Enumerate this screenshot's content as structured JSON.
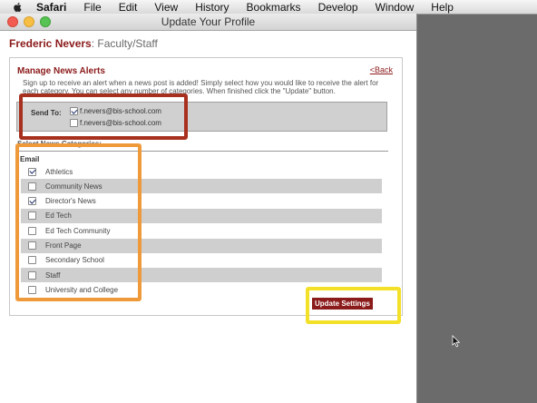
{
  "menubar": {
    "items": [
      "Safari",
      "File",
      "Edit",
      "View",
      "History",
      "Bookmarks",
      "Develop",
      "Window",
      "Help"
    ]
  },
  "window": {
    "title": "Update Your Profile"
  },
  "profile": {
    "name": "Frederic Nevers",
    "role": ": Faculty/Staff"
  },
  "alerts": {
    "title": "Manage News Alerts",
    "back_label": "<Back",
    "intro": "Sign up to receive an alert when a news post is added! Simply select how you would like to receive the alert for each category. You can select any number of categories. When finished click the \"Update\" button.",
    "send_to_label": "Send To:",
    "emails": [
      {
        "address": "f.nevers@bis-school.com",
        "checked": true
      },
      {
        "address": "f.nevers@bis-school.com",
        "checked": false
      }
    ],
    "categories_title": "Select News Categories:",
    "email_column_label": "Email",
    "categories": [
      {
        "name": "Athletics",
        "checked": true
      },
      {
        "name": "Community News",
        "checked": false
      },
      {
        "name": "Director's News",
        "checked": true
      },
      {
        "name": "Ed Tech",
        "checked": false
      },
      {
        "name": "Ed Tech Community",
        "checked": false
      },
      {
        "name": "Front Page",
        "checked": false
      },
      {
        "name": "Secondary School",
        "checked": false
      },
      {
        "name": "Staff",
        "checked": false
      },
      {
        "name": "University and College",
        "checked": false
      }
    ],
    "update_label": "Update Settings"
  },
  "colors": {
    "brand": "#8b1a1a",
    "highlight_red": "#a7301e",
    "highlight_orange": "#ef9a3a",
    "highlight_yellow": "#f3e028"
  }
}
